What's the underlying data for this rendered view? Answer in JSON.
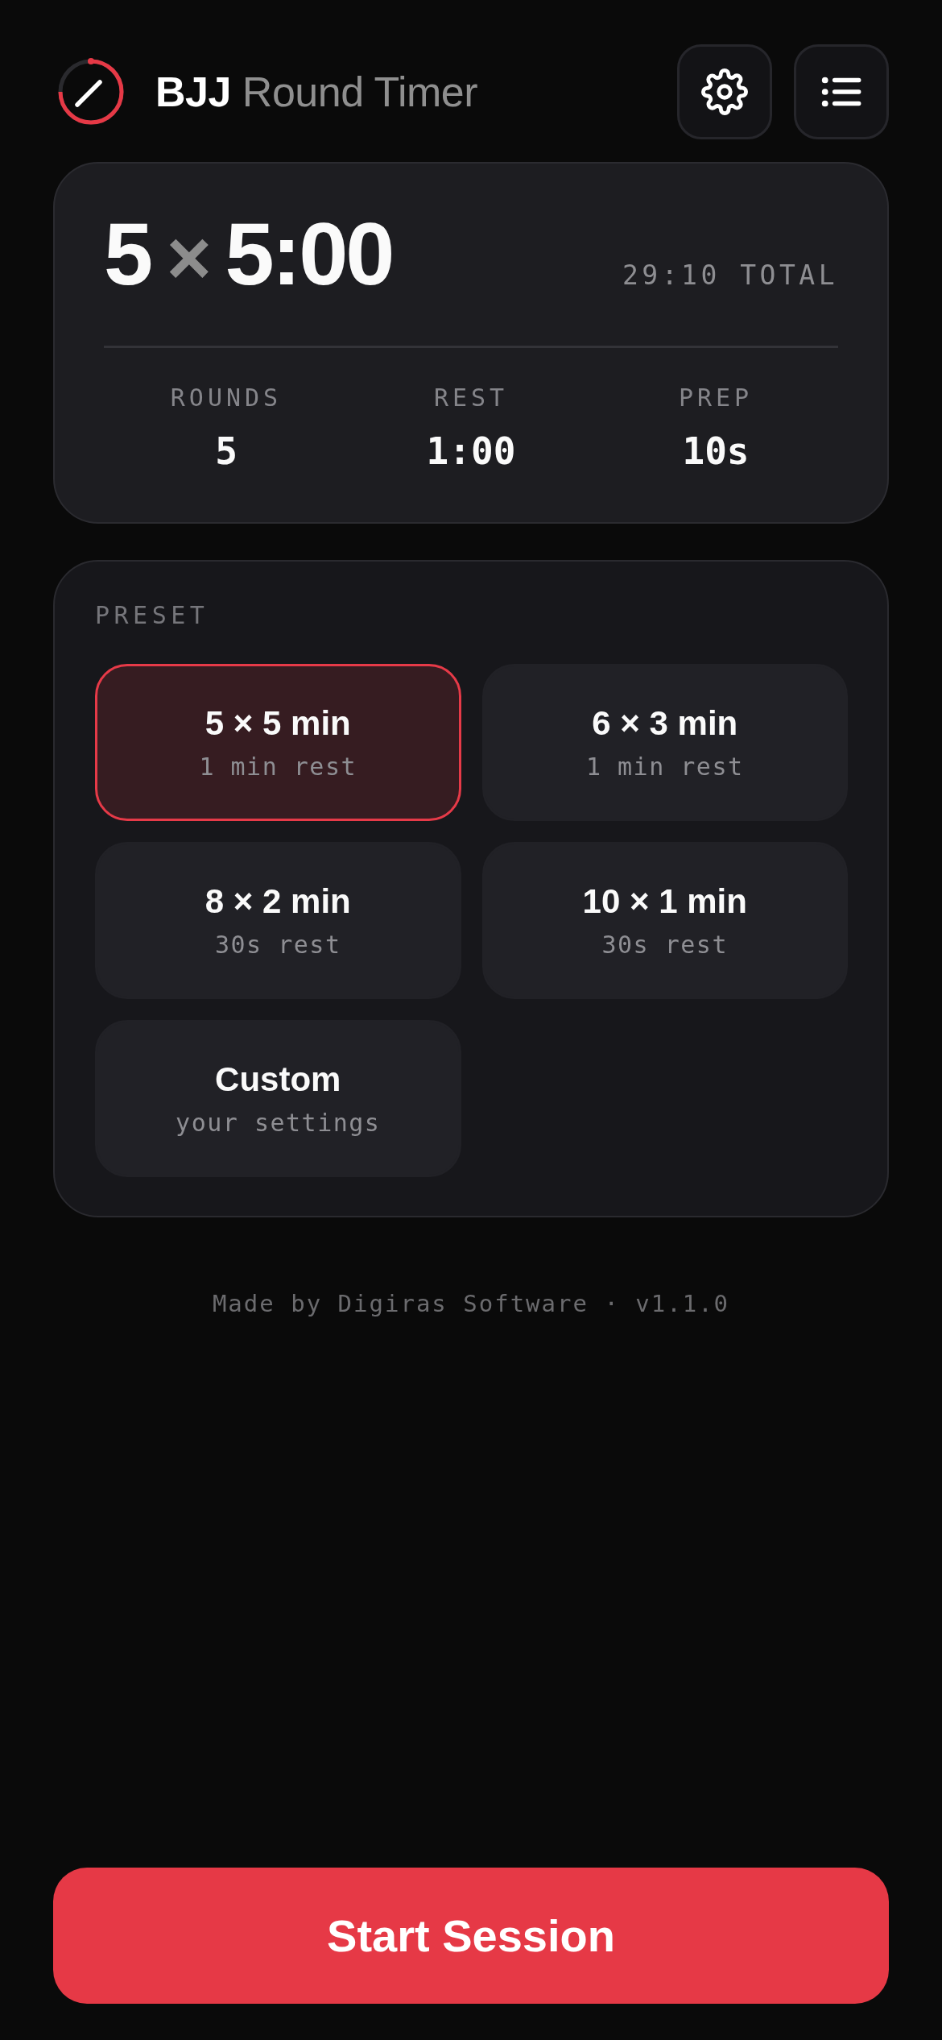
{
  "header": {
    "title": "**BJJ** Round Timer"
  },
  "summary": {
    "headline": {
      "count": "5",
      "sign": "×",
      "length": "5:00"
    },
    "total": "29:10 TOTAL",
    "stats": [
      {
        "label": "ROUNDS",
        "value": "5"
      },
      {
        "label": "REST",
        "value": "1:00"
      },
      {
        "label": "PREP",
        "value": "10s"
      }
    ]
  },
  "presets": {
    "label": "PRESET",
    "items": [
      {
        "title": "5 × 5 min",
        "subtitle": "1 min rest",
        "selected": true
      },
      {
        "title": "6 × 3 min",
        "subtitle": "1 min rest",
        "selected": false
      },
      {
        "title": "8 × 2 min",
        "subtitle": "30s rest",
        "selected": false
      },
      {
        "title": "10 × 1 min",
        "subtitle": "30s rest",
        "selected": false
      },
      {
        "title": "Custom",
        "subtitle": "your settings",
        "selected": false
      }
    ]
  },
  "footer": "Made by Digiras Software · v1.1.0",
  "start_button": "Start Session"
}
